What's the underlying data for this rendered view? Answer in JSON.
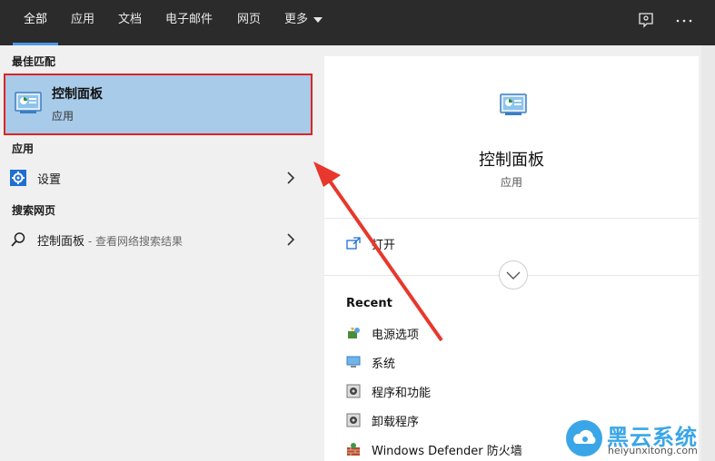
{
  "tabs": [
    {
      "label": "全部",
      "active": true
    },
    {
      "label": "应用"
    },
    {
      "label": "文档"
    },
    {
      "label": "电子邮件"
    },
    {
      "label": "网页"
    },
    {
      "label": "更多"
    }
  ],
  "topbar_icons": [
    "feedback-icon",
    "more-options-icon"
  ],
  "left": {
    "best_match_label": "最佳匹配",
    "best_match": {
      "title": "控制面板",
      "subtitle": "应用",
      "icon": "control-panel-icon"
    },
    "apps_label": "应用",
    "apps": [
      {
        "label": "设置",
        "icon": "gear-icon"
      }
    ],
    "web_label": "搜索网页",
    "web": [
      {
        "label": "控制面板",
        "desc": " - 查看网络搜索结果",
        "icon": "search-icon"
      }
    ]
  },
  "right": {
    "title": "控制面板",
    "subtitle": "应用",
    "open_label": "打开",
    "recent_title": "Recent",
    "recent": [
      {
        "label": "电源选项",
        "icon": "power-options-icon"
      },
      {
        "label": "系统",
        "icon": "monitor-icon"
      },
      {
        "label": "程序和功能",
        "icon": "programs-icon"
      },
      {
        "label": "卸载程序",
        "icon": "uninstall-icon"
      },
      {
        "label": "Windows Defender 防火墙",
        "icon": "firewall-icon"
      }
    ]
  },
  "watermark": {
    "name": "黑云系统",
    "url": "heiyunxitong.com"
  },
  "colors": {
    "topbar": "#2b2b2b",
    "selection": "#a7cbe9",
    "highlight_border": "#e02424",
    "accent": "#4a98e8"
  }
}
